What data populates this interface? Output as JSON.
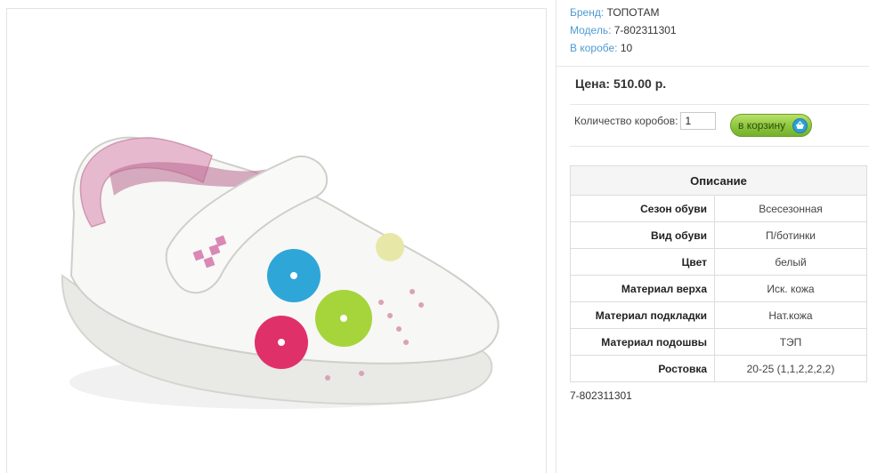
{
  "product": {
    "brand_label": "Бренд:",
    "brand_value": "ТОПОТАМ",
    "model_label": "Модель:",
    "model_value": "7-802311301",
    "box_label": "В коробе:",
    "box_value": "10",
    "price_text": "Цена: 510.00 р.",
    "qty_label": "Количество коробов:",
    "qty_value": "1",
    "cart_label": "в корзину",
    "footer_sku": "7-802311301"
  },
  "specs": {
    "title": "Описание",
    "rows": [
      {
        "key": "Сезон обуви",
        "value": "Всесезонная"
      },
      {
        "key": "Вид обуви",
        "value": "П/ботинки"
      },
      {
        "key": "Цвет",
        "value": "белый"
      },
      {
        "key": "Материал верха",
        "value": "Иск. кожа"
      },
      {
        "key": "Материал подкладки",
        "value": "Нат.кожа"
      },
      {
        "key": "Материал подошвы",
        "value": "ТЭП"
      },
      {
        "key": "Ростовка",
        "value": "20-25 (1,1,2,2,2,2)"
      }
    ]
  },
  "colors": {
    "link_blue": "#4f9bd2",
    "button_green": "#8cc63e",
    "cart_icon_blue": "#2d9fd3"
  },
  "icons": {
    "cart": "cart-icon"
  }
}
